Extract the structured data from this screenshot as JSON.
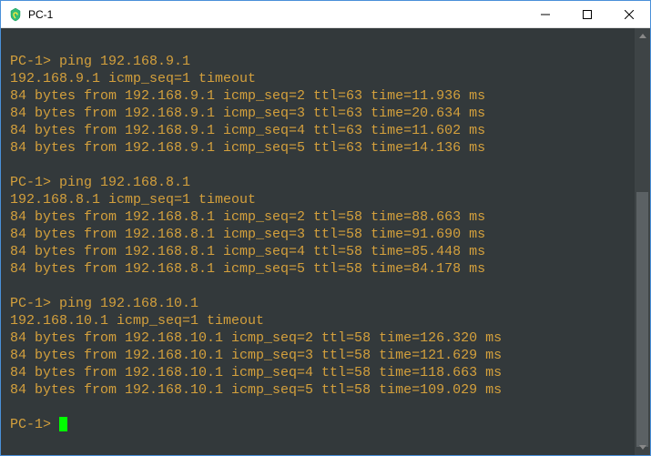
{
  "window": {
    "title": "PC-1"
  },
  "terminal": {
    "prompt": "PC-1>",
    "sessions": [
      {
        "command": "ping 192.168.9.1",
        "timeout_line": "192.168.9.1 icmp_seq=1 timeout",
        "replies": [
          "84 bytes from 192.168.9.1 icmp_seq=2 ttl=63 time=11.936 ms",
          "84 bytes from 192.168.9.1 icmp_seq=3 ttl=63 time=20.634 ms",
          "84 bytes from 192.168.9.1 icmp_seq=4 ttl=63 time=11.602 ms",
          "84 bytes from 192.168.9.1 icmp_seq=5 ttl=63 time=14.136 ms"
        ]
      },
      {
        "command": "ping 192.168.8.1",
        "timeout_line": "192.168.8.1 icmp_seq=1 timeout",
        "replies": [
          "84 bytes from 192.168.8.1 icmp_seq=2 ttl=58 time=88.663 ms",
          "84 bytes from 192.168.8.1 icmp_seq=3 ttl=58 time=91.690 ms",
          "84 bytes from 192.168.8.1 icmp_seq=4 ttl=58 time=85.448 ms",
          "84 bytes from 192.168.8.1 icmp_seq=5 ttl=58 time=84.178 ms"
        ]
      },
      {
        "command": "ping 192.168.10.1",
        "timeout_line": "192.168.10.1 icmp_seq=1 timeout",
        "replies": [
          "84 bytes from 192.168.10.1 icmp_seq=2 ttl=58 time=126.320 ms",
          "84 bytes from 192.168.10.1 icmp_seq=3 ttl=58 time=121.629 ms",
          "84 bytes from 192.168.10.1 icmp_seq=4 ttl=58 time=118.663 ms",
          "84 bytes from 192.168.10.1 icmp_seq=5 ttl=58 time=109.029 ms"
        ]
      }
    ],
    "final_prompt": "PC-1> "
  }
}
